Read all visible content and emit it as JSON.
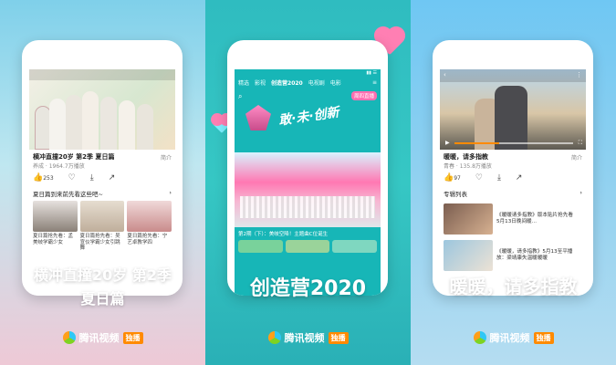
{
  "panels": [
    {
      "tagline_line1": "横冲直撞20岁 第2季",
      "tagline_line2": "夏日篇",
      "show_title": "横冲直撞20岁 第2季 夏日篇",
      "views": "养成 · 1964.7万播放",
      "intro_label": "简介",
      "likes": "253",
      "section_title": "夏日篇到来前先看这些吧~",
      "thumb_caps": [
        "夏日篇抢先看：孟美岐学霸少女",
        "夏日篇抢先看：吴宣仪学霸少女引跳舞",
        "夏日篇抢先看：宁艺卓教学四"
      ],
      "brand_text": "腾讯视频",
      "brand_badge": "独播"
    },
    {
      "tagline": "创造营2020",
      "tabs": [
        "精选",
        "影视",
        "创造营2020",
        "电视剧",
        "电影"
      ],
      "logo_text": "创造营 2020",
      "page_label": "周四直播",
      "art_text": "敢·未·创新",
      "caption": "第2期（下）：美岐空降！主题曲C位诞生",
      "brand_text": "腾讯视频",
      "brand_badge": "独播"
    },
    {
      "tagline": "暖暖，请多指教",
      "show_title": "暖暖，请多指教",
      "views": "青春 · 135.8万播放",
      "intro_label": "简介",
      "likes": "97",
      "section_title": "专辑列表",
      "items": [
        {
          "title": "《暖暖请多指教》版本贴片抢先看",
          "sub": "5月13日晚间暖..."
        },
        {
          "title": "《暖暖，请多指教》5月13至平播放：梁靖康失温暖暖暖"
        }
      ],
      "brand_text": "腾讯视频",
      "brand_badge": "独播"
    }
  ],
  "colors": {
    "panel1_bg": "#7fd0ea",
    "panel2_bg": "#2fbcc0",
    "panel3_bg": "#6fc7f3",
    "accent": "#ff8a00"
  }
}
